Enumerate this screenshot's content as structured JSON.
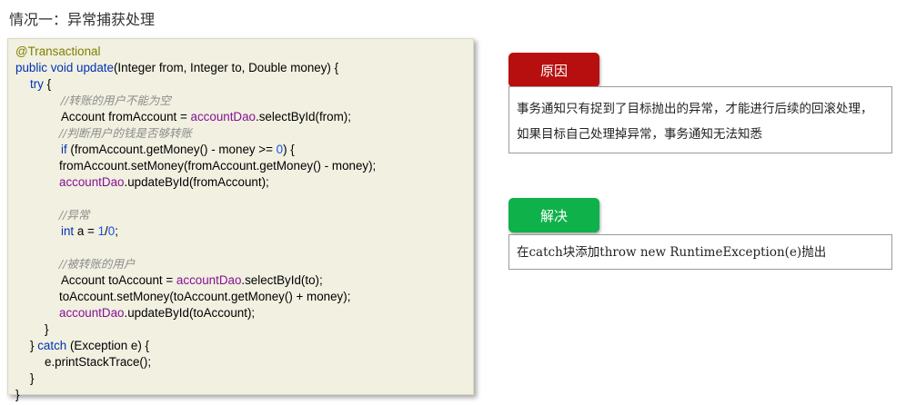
{
  "heading": "情况一：异常捕获处理",
  "code": {
    "lines": [
      {
        "x": 8,
        "cmt": false,
        "segs": [
          {
            "c": "ann",
            "t": "@Transactional"
          }
        ]
      },
      {
        "x": 8,
        "cmt": false,
        "segs": [
          {
            "c": "kw",
            "t": "public void "
          },
          {
            "c": "kw",
            "t": "update"
          },
          {
            "c": "pl",
            "t": "(Integer from, Integer to, Double money) {"
          }
        ]
      },
      {
        "x": 24,
        "cmt": false,
        "segs": [
          {
            "c": "kw",
            "t": "try"
          },
          {
            "c": "pl",
            "t": " {"
          }
        ]
      },
      {
        "x": 58,
        "cmt": true,
        "segs": [
          {
            "c": "cmt",
            "t": "//转账的用户不能为空"
          }
        ]
      },
      {
        "x": 58,
        "cmt": false,
        "segs": [
          {
            "c": "pl",
            "t": "Account fromAccount = "
          },
          {
            "c": "fld",
            "t": "accountDao"
          },
          {
            "c": "pl",
            "t": ".selectById(from);"
          }
        ]
      },
      {
        "x": 56,
        "cmt": true,
        "segs": [
          {
            "c": "cmt",
            "t": "//判断用户的钱是否够转账"
          }
        ]
      },
      {
        "x": 58,
        "cmt": false,
        "segs": [
          {
            "c": "kw",
            "t": "if"
          },
          {
            "c": "pl",
            "t": " (fromAccount.getMoney() - money >= "
          },
          {
            "c": "num",
            "t": "0"
          },
          {
            "c": "pl",
            "t": ") {"
          }
        ]
      },
      {
        "x": 56,
        "cmt": false,
        "segs": [
          {
            "c": "pl",
            "t": "fromAccount.setMoney(fromAccount.getMoney() - money);"
          }
        ]
      },
      {
        "x": 56,
        "cmt": false,
        "segs": [
          {
            "c": "fld",
            "t": "accountDao"
          },
          {
            "c": "pl",
            "t": ".updateById(fromAccount);"
          }
        ]
      },
      {
        "x": 56,
        "cmt": false,
        "segs": [
          {
            "c": "pl",
            "t": ""
          }
        ]
      },
      {
        "x": 56,
        "cmt": true,
        "segs": [
          {
            "c": "cmt",
            "t": "//异常"
          }
        ]
      },
      {
        "x": 58,
        "cmt": false,
        "segs": [
          {
            "c": "kw",
            "t": "int"
          },
          {
            "c": "pl",
            "t": " a = "
          },
          {
            "c": "num",
            "t": "1"
          },
          {
            "c": "pl",
            "t": "/"
          },
          {
            "c": "num",
            "t": "0"
          },
          {
            "c": "pl",
            "t": ";"
          }
        ]
      },
      {
        "x": 56,
        "cmt": false,
        "segs": [
          {
            "c": "pl",
            "t": ""
          }
        ]
      },
      {
        "x": 56,
        "cmt": true,
        "segs": [
          {
            "c": "cmt",
            "t": "//被转账的用户"
          }
        ]
      },
      {
        "x": 58,
        "cmt": false,
        "segs": [
          {
            "c": "pl",
            "t": "Account toAccount = "
          },
          {
            "c": "fld",
            "t": "accountDao"
          },
          {
            "c": "pl",
            "t": ".selectById(to);"
          }
        ]
      },
      {
        "x": 56,
        "cmt": false,
        "segs": [
          {
            "c": "pl",
            "t": "toAccount.setMoney(toAccount.getMoney() + money);"
          }
        ]
      },
      {
        "x": 56,
        "cmt": false,
        "segs": [
          {
            "c": "fld",
            "t": "accountDao"
          },
          {
            "c": "pl",
            "t": ".updateById(toAccount);"
          }
        ]
      },
      {
        "x": 40,
        "cmt": false,
        "segs": [
          {
            "c": "pl",
            "t": "}"
          }
        ]
      },
      {
        "x": 24,
        "cmt": false,
        "segs": [
          {
            "c": "pl",
            "t": "} "
          },
          {
            "c": "kw",
            "t": "catch"
          },
          {
            "c": "pl",
            "t": " (Exception e) {"
          }
        ]
      },
      {
        "x": 40,
        "cmt": false,
        "segs": [
          {
            "c": "pl",
            "t": "e.printStackTrace();"
          }
        ]
      },
      {
        "x": 24,
        "cmt": false,
        "segs": [
          {
            "c": "pl",
            "t": "}"
          }
        ]
      },
      {
        "x": 8,
        "cmt": false,
        "segs": [
          {
            "c": "pl",
            "t": "}"
          }
        ]
      }
    ]
  },
  "reason": {
    "label": "原因",
    "text": "事务通知只有捉到了目标抛出的异常，才能进行后续的回滚处理，如果目标自己处理掉异常，事务通知无法知悉"
  },
  "solution": {
    "label": "解决",
    "text": "在catch块添加throw new RuntimeException(e)抛出"
  },
  "colors": {
    "code_bg": "#f1f0e1",
    "annotation": "#808000",
    "keyword": "#0033b3",
    "field": "#871094",
    "number": "#1750eb",
    "comment": "#8c8c8c",
    "reason_badge": "#b70f0f",
    "solution_badge": "#0fb14a"
  }
}
